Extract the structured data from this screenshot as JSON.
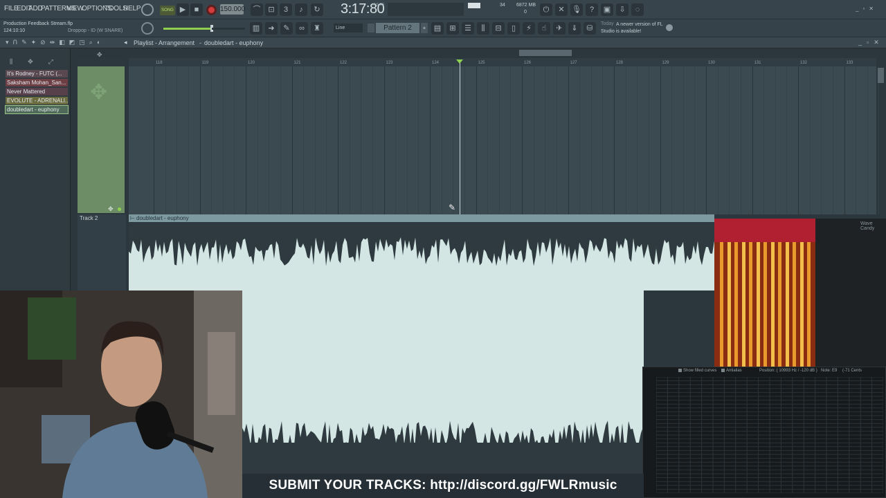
{
  "menu": [
    "FILE",
    "EDIT",
    "ADD",
    "PATTERNS",
    "VIEW",
    "OPTIONS",
    "TOOLS",
    "HELP"
  ],
  "transport": {
    "song_label": "SONG",
    "tempo": "150.000",
    "time": "3:17:80",
    "time_label": "M:S:CS"
  },
  "monitor": {
    "cpu": "34",
    "memory": "6872 MB",
    "polyphony": "0"
  },
  "project": {
    "title": "Production Feedback Stream.flp",
    "position": "124:10:10",
    "hint": "Droppop - ID (W SNARE)"
  },
  "snap": "Line",
  "pattern": "Pattern 2",
  "news": {
    "date": "Today",
    "text": "A newer version of FL Studio is available!"
  },
  "playlist": {
    "title": "Playlist - Arrangement",
    "clip_name": "doubledart - euphony",
    "ruler": [
      "118",
      "119",
      "120",
      "121",
      "122",
      "123",
      "124",
      "125",
      "126",
      "127",
      "128",
      "129",
      "130",
      "131",
      "132",
      "133"
    ]
  },
  "browser_items": [
    "It's Rodney - FUTC (...",
    "Saksham Mohan_San...",
    "Never Mattered",
    "EVOLUTE - ADRENALI...",
    "doubledart - euphony"
  ],
  "track2": "Track 2",
  "analyzer": {
    "show_filled": "Show filled curves",
    "antialias": "Antialias",
    "position": "Position: ( 10993 Hz / -120 dB )",
    "note": "Note: E9",
    "cents": "(-71 Cents"
  },
  "plugin_label": "Wave Candy",
  "banner": "SUBMIT YOUR TRACKS: http://discord.gg/FWLRmusic",
  "accent_green": "#8fd14f",
  "record_red": "#d23c3c"
}
